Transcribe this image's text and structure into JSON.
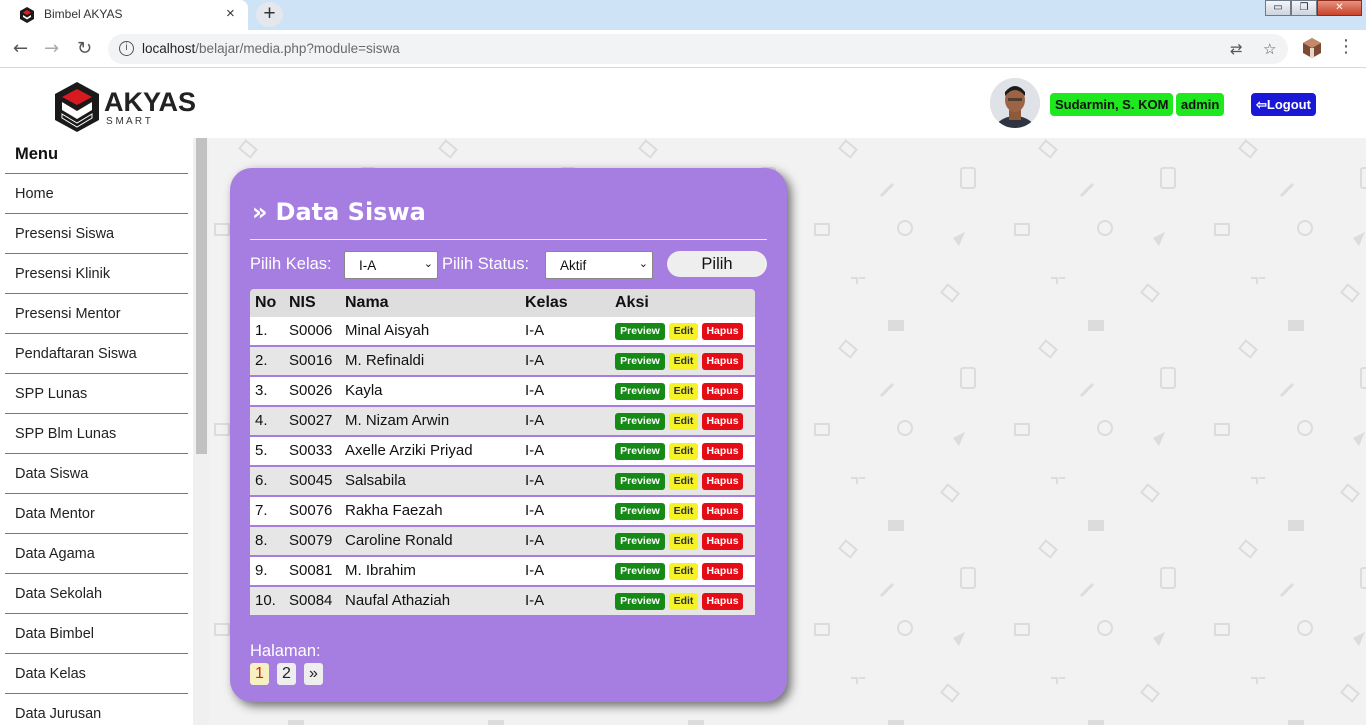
{
  "browser": {
    "tab_title": "Bimbel AKYAS",
    "tab_close": "×",
    "new_tab": "+",
    "url_host": "localhost",
    "url_path": "/belajar/media.php?module=siswa",
    "window_buttons": [
      "▭",
      "❐",
      "✕"
    ]
  },
  "header": {
    "logo_text": "AKYAS",
    "logo_sub": "S M A R T",
    "user_name": "Sudarmin, S. KOM",
    "user_role": "admin",
    "logout_label": "Logout"
  },
  "sidebar": {
    "title": "Menu",
    "items": [
      "Home",
      "Presensi Siswa",
      "Presensi Klinik",
      "Presensi Mentor",
      "Pendaftaran Siswa",
      "SPP Lunas",
      "SPP Blm Lunas",
      "Data Siswa",
      "Data Mentor",
      "Data Agama",
      "Data Sekolah",
      "Data Bimbel",
      "Data Kelas",
      "Data Jurusan"
    ]
  },
  "main": {
    "title": "Data Siswa",
    "title_prefix": "»",
    "filter": {
      "kelas_label": "Pilih Kelas:",
      "kelas_value": "I-A",
      "status_label": "Pilih Status:",
      "status_value": "Aktif",
      "submit_label": "Pilih"
    },
    "table": {
      "headers": [
        "No",
        "NIS",
        "Nama",
        "Kelas",
        "Aksi"
      ],
      "rows": [
        {
          "no": "1.",
          "nis": "S0006",
          "nama": "Minal Aisyah",
          "kelas": "I-A"
        },
        {
          "no": "2.",
          "nis": "S0016",
          "nama": "M. Refinaldi",
          "kelas": "I-A"
        },
        {
          "no": "3.",
          "nis": "S0026",
          "nama": "Kayla",
          "kelas": "I-A"
        },
        {
          "no": "4.",
          "nis": "S0027",
          "nama": "M. Nizam Arwin",
          "kelas": "I-A"
        },
        {
          "no": "5.",
          "nis": "S0033",
          "nama": "Axelle Arziki Priyad",
          "kelas": "I-A"
        },
        {
          "no": "6.",
          "nis": "S0045",
          "nama": "Salsabila",
          "kelas": "I-A"
        },
        {
          "no": "7.",
          "nis": "S0076",
          "nama": "Rakha Faezah",
          "kelas": "I-A"
        },
        {
          "no": "8.",
          "nis": "S0079",
          "nama": "Caroline Ronald",
          "kelas": "I-A"
        },
        {
          "no": "9.",
          "nis": "S0081",
          "nama": "M. Ibrahim",
          "kelas": "I-A"
        },
        {
          "no": "10.",
          "nis": "S0084",
          "nama": "Naufal Athaziah",
          "kelas": "I-A"
        }
      ],
      "actions": {
        "preview": "Preview",
        "edit": "Edit",
        "hapus": "Hapus"
      }
    },
    "pagination": {
      "label": "Halaman:",
      "pages": [
        "1",
        "2",
        "»"
      ],
      "current": "1"
    }
  },
  "colors": {
    "card": "#a67de0",
    "badge": "#1ee81e",
    "logout": "#1a17d6",
    "preview": "#168a16",
    "edit": "#f5f226",
    "hapus": "#e40d16"
  }
}
